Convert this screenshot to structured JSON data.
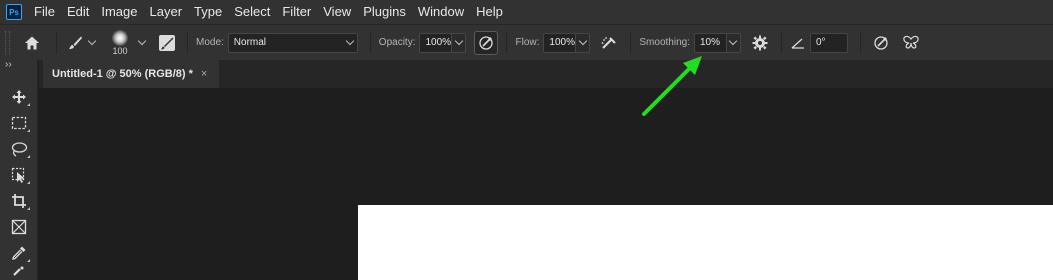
{
  "app": {
    "logo_text": "Ps"
  },
  "menu": [
    "File",
    "Edit",
    "Image",
    "Layer",
    "Type",
    "Select",
    "Filter",
    "View",
    "Plugins",
    "Window",
    "Help"
  ],
  "options": {
    "brush_size": "100",
    "mode_label": "Mode:",
    "mode_value": "Normal",
    "opacity_label": "Opacity:",
    "opacity_value": "100%",
    "flow_label": "Flow:",
    "flow_value": "100%",
    "smoothing_label": "Smoothing:",
    "smoothing_value": "10%",
    "angle_value": "0°"
  },
  "document": {
    "tab_title": "Untitled-1 @ 50% (RGB/8) *",
    "close_glyph": "×"
  },
  "toolbox": {
    "collapse_glyph": "››",
    "tools": [
      "move-tool-icon",
      "marquee-tool-icon",
      "lasso-tool-icon",
      "object-selection-tool-icon",
      "crop-tool-icon",
      "frame-tool-icon",
      "eyedropper-tool-icon"
    ]
  },
  "colors": {
    "annotation_arrow": "#22dd22",
    "ps_accent": "#31a8ff"
  }
}
